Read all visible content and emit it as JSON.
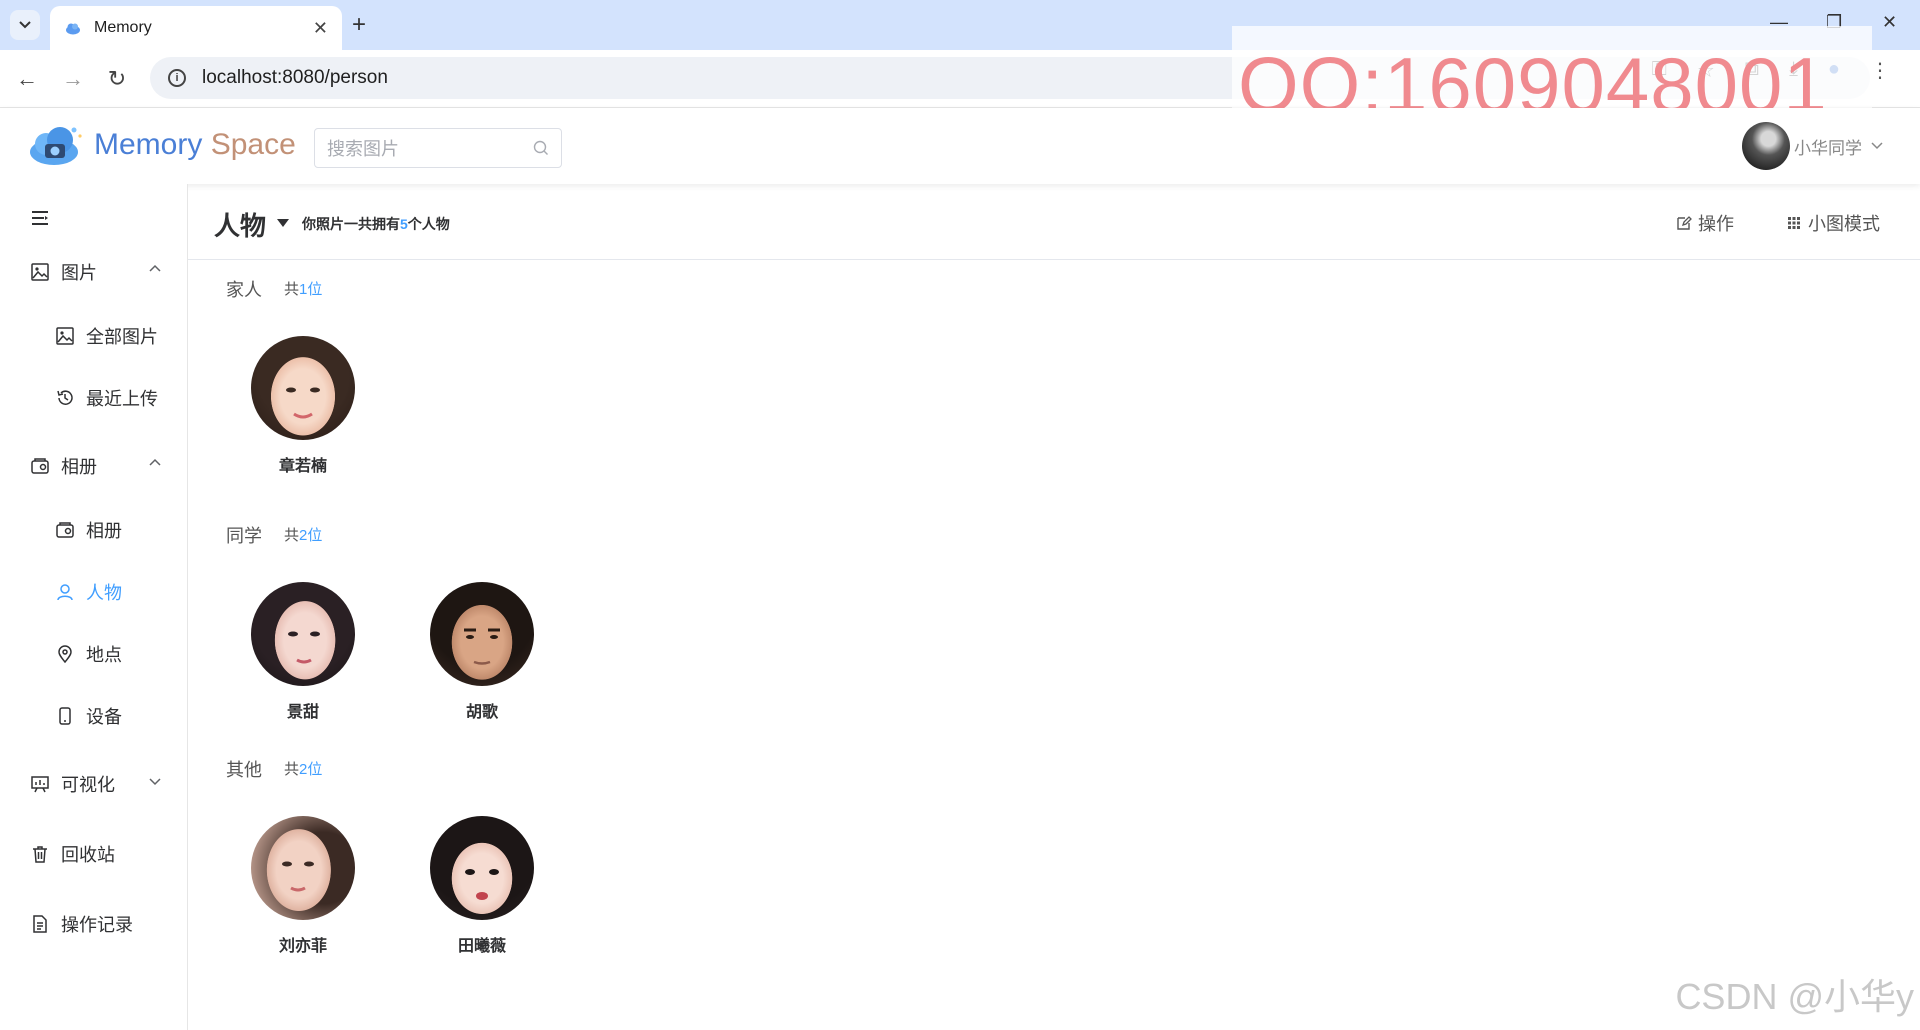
{
  "browser": {
    "tab_title": "Memory",
    "url": "localhost:8080/person",
    "overlay_text": "QQ:1609048001"
  },
  "header": {
    "brand_memory": "Memory",
    "brand_space": "Space",
    "search_placeholder": "搜索图片",
    "user_name": "小华同学"
  },
  "sidebar": {
    "items": [
      {
        "label": "图片"
      },
      {
        "label": "全部图片"
      },
      {
        "label": "最近上传"
      },
      {
        "label": "相册"
      },
      {
        "label": "相册"
      },
      {
        "label": "人物"
      },
      {
        "label": "地点"
      },
      {
        "label": "设备"
      },
      {
        "label": "可视化"
      },
      {
        "label": "回收站"
      },
      {
        "label": "操作记录"
      }
    ]
  },
  "page": {
    "title": "人物",
    "summary_prefix": "你照片一共拥有",
    "summary_count": "5",
    "summary_suffix": "个人物",
    "action_operate": "操作",
    "action_view": "小图模式"
  },
  "groups": [
    {
      "name": "家人",
      "count_prefix": "共",
      "count": "1",
      "count_suffix": "位",
      "people": [
        {
          "name": "章若楠"
        }
      ]
    },
    {
      "name": "同学",
      "count_prefix": "共",
      "count": "2",
      "count_suffix": "位",
      "people": [
        {
          "name": "景甜"
        },
        {
          "name": "胡歌"
        }
      ]
    },
    {
      "name": "其他",
      "count_prefix": "共",
      "count": "2",
      "count_suffix": "位",
      "people": [
        {
          "name": "刘亦菲"
        },
        {
          "name": "田曦薇"
        }
      ]
    }
  ],
  "watermark": "CSDN @小华y",
  "colors": {
    "accent": "#409eff",
    "brand_blue": "#4a7fd6",
    "overlay_red": "#f08a8f"
  }
}
